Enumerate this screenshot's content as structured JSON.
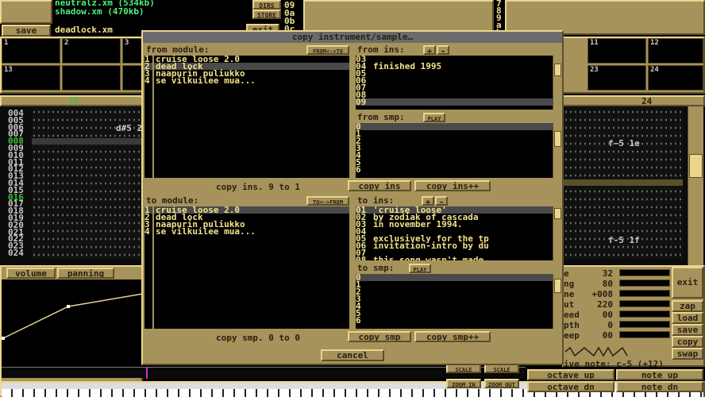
{
  "top": {
    "files": [
      "neutralz.xm (534kb)",
      "shadow.xm (470kb)"
    ],
    "save_label": "save",
    "filename": "deadlock.xm",
    "dirs_label": "DIRS",
    "store_label": "STORE",
    "exit_label": "exit",
    "hex_rows": [
      "09",
      "0a",
      "0b",
      "0c"
    ],
    "right_digits": [
      "7",
      "8",
      "9",
      "a",
      "b"
    ]
  },
  "scopes": [
    "1",
    "2",
    "3",
    "11",
    "12",
    "13",
    "23",
    "24"
  ],
  "pattern": {
    "left_channel": "17",
    "right_channel": "24",
    "rows": [
      "004",
      "005",
      "006",
      "007",
      "008",
      "009",
      "010",
      "011",
      "012",
      "013",
      "014",
      "015",
      "016",
      "017",
      "018",
      "019",
      "020",
      "021",
      "022",
      "023",
      "024"
    ],
    "note_left": "d#5 2",
    "note_right_a": "f-5 1e",
    "note_right_b": "f-5 1f"
  },
  "envelope": {
    "volume_tab": "volume",
    "panning_tab": "panning"
  },
  "right_panel": {
    "params": [
      {
        "label": "e",
        "value": "32"
      },
      {
        "label": "ng",
        "value": "80"
      },
      {
        "label": "ne",
        "value": "+008"
      },
      {
        "label": "ut",
        "value": "220"
      },
      {
        "label": "eed",
        "value": "00"
      },
      {
        "label": "pth",
        "value": "0"
      },
      {
        "label": "eep",
        "value": "00"
      }
    ],
    "exit": "exit",
    "zap": "zap",
    "load": "load",
    "save": "save",
    "copy": "copy",
    "swap": "swap",
    "relative_note": "ive note: c-5 (+12)",
    "octave_up": "octave up",
    "octave_dn": "octave dn",
    "note_up": "note up",
    "note_dn": "note dn",
    "scale1": "SCALE",
    "scale2": "SCALE",
    "zoom_in": "ZOOM IN",
    "zoom_out": "ZOOM OUT"
  },
  "dialog": {
    "title": "copy instrument/sample…",
    "from_module_label": "from module:",
    "from_to_btn": "FROM<->TO",
    "from_modules": [
      "cruise loose 2.0",
      "dead lock",
      "naapurin puliukko",
      "se vilkuilee mua..."
    ],
    "from_modules_sel": 1,
    "from_ins_label": "from ins:",
    "from_ins_nums": [
      "03",
      "04",
      "05",
      "06",
      "07",
      "08",
      "09"
    ],
    "from_ins_text": [
      "",
      "finished 1995",
      "",
      "",
      "",
      "",
      ""
    ],
    "from_ins_sel": 6,
    "from_smp_label": "from smp:",
    "play_label": "PLAY",
    "smp_nums": [
      "0",
      "1",
      "2",
      "3",
      "4",
      "5",
      "6"
    ],
    "copy_ins_status": "copy ins. 9 to 1",
    "copy_ins_btn": "copy ins",
    "copy_ins_pp_btn": "copy ins++",
    "to_module_label": "to module:",
    "to_from_btn": "TO<->FROM",
    "to_modules": [
      "cruise loose 2.0",
      "dead lock",
      "naapurin puliukko",
      "se vilkuilee mua..."
    ],
    "to_modules_sel": 0,
    "to_ins_label": "to ins:",
    "to_ins_nums": [
      "01",
      "02",
      "03",
      "04",
      "05",
      "06",
      "07",
      "08"
    ],
    "to_ins_text": [
      "'cruise loose'",
      "by zodiak of cascada",
      "in november 1994.",
      "",
      "exclusively for the tp",
      "invitation-intro by du",
      "",
      "this song wasn't made"
    ],
    "to_ins_sel": 0,
    "to_smp_label": "to smp:",
    "copy_smp_status": "copy smp. 0 to 0",
    "copy_smp_btn": "copy smp",
    "copy_smp_pp_btn": "copy smp++",
    "cancel_label": "cancel"
  }
}
